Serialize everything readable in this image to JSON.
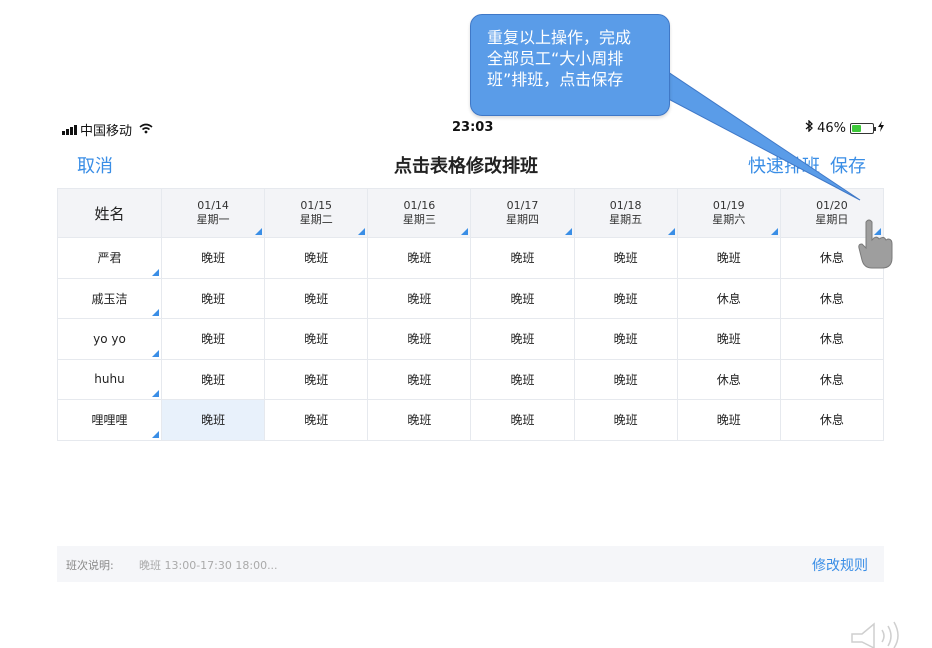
{
  "callout": {
    "line1": "重复以上操作，完成",
    "line2": "全部员工“大小周排",
    "line3": "班”排班，点击保存"
  },
  "status_bar": {
    "carrier": "中国移动",
    "time": "23:03",
    "battery": "46%",
    "battery_level": 0.46
  },
  "nav": {
    "cancel": "取消",
    "title": "点击表格修改排班",
    "quick_schedule": "快速排班",
    "save": "保存"
  },
  "table": {
    "name_header": "姓名",
    "days": [
      {
        "date": "01/14",
        "weekday": "星期一"
      },
      {
        "date": "01/15",
        "weekday": "星期二"
      },
      {
        "date": "01/16",
        "weekday": "星期三"
      },
      {
        "date": "01/17",
        "weekday": "星期四"
      },
      {
        "date": "01/18",
        "weekday": "星期五"
      },
      {
        "date": "01/19",
        "weekday": "星期六"
      },
      {
        "date": "01/20",
        "weekday": "星期日"
      }
    ],
    "rows": [
      {
        "name": "严君",
        "shifts": [
          "晚班",
          "晚班",
          "晚班",
          "晚班",
          "晚班",
          "晚班",
          "休息"
        ]
      },
      {
        "name": "戚玉洁",
        "shifts": [
          "晚班",
          "晚班",
          "晚班",
          "晚班",
          "晚班",
          "休息",
          "休息"
        ]
      },
      {
        "name": "yo yo",
        "shifts": [
          "晚班",
          "晚班",
          "晚班",
          "晚班",
          "晚班",
          "晚班",
          "休息"
        ]
      },
      {
        "name": "huhu",
        "shifts": [
          "晚班",
          "晚班",
          "晚班",
          "晚班",
          "晚班",
          "休息",
          "休息"
        ]
      },
      {
        "name": "哩哩哩",
        "shifts": [
          "晚班",
          "晚班",
          "晚班",
          "晚班",
          "晚班",
          "晚班",
          "休息"
        ]
      }
    ]
  },
  "bottom_bar": {
    "label": "班次说明:",
    "description": "晚班 13:00-17:30  18:00...",
    "link": "修改规则"
  },
  "colors": {
    "accent": "#3a8ee6",
    "callout_bg": "#5a9ce8",
    "header_bg": "#f3f4f7",
    "battery": "#3ec93a"
  }
}
